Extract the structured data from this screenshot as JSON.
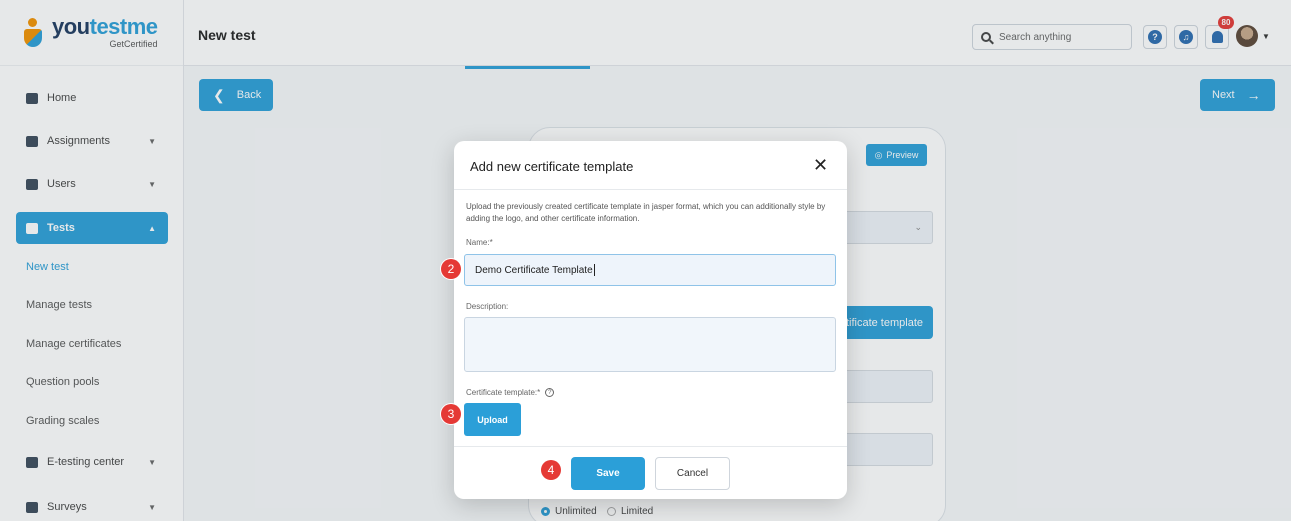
{
  "brand": {
    "name_part1": "you",
    "name_part2": "testme",
    "sub": "GetCertified"
  },
  "sidebar": {
    "items": [
      {
        "label": "Home"
      },
      {
        "label": "Assignments"
      },
      {
        "label": "Users"
      },
      {
        "label": "Tests"
      },
      {
        "label": "E-testing center"
      },
      {
        "label": "Surveys"
      }
    ],
    "sub_items": [
      {
        "label": "New test"
      },
      {
        "label": "Manage tests"
      },
      {
        "label": "Manage certificates"
      },
      {
        "label": "Question pools"
      },
      {
        "label": "Grading scales"
      }
    ]
  },
  "header": {
    "title": "New test",
    "search_placeholder": "Search anything",
    "notification_count": "80"
  },
  "content": {
    "back_label": "Back",
    "next_label": "Next",
    "preview_label": "Preview",
    "cert_button_label": "tificate template",
    "radio_unlimited": "Unlimited",
    "radio_limited": "Limited"
  },
  "modal": {
    "title": "Add new certificate template",
    "description": "Upload the previously created certificate template in jasper format, which you can additionally style by adding the logo, and other certificate information.",
    "name_label": "Name:*",
    "name_value": "Demo Certificate Template",
    "description_label": "Description:",
    "template_label": "Certificate template:*",
    "upload_label": "Upload",
    "save_label": "Save",
    "cancel_label": "Cancel"
  },
  "steps": [
    "2",
    "3",
    "4"
  ],
  "colors": {
    "accent": "#2b9fd8",
    "step": "#e53935",
    "brand_orange": "#f39200"
  }
}
